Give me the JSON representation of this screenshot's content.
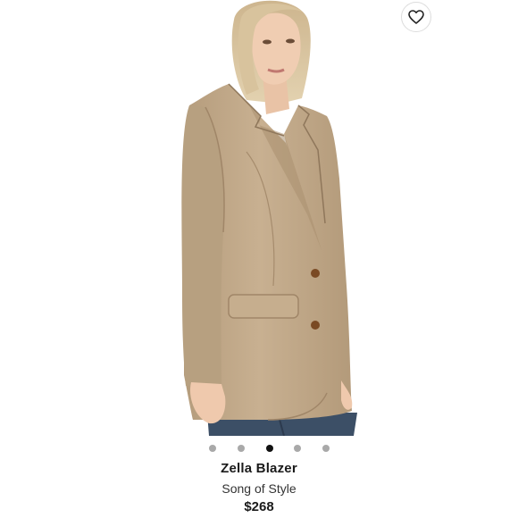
{
  "product": {
    "name": "Zella Blazer",
    "brand": "Song of Style",
    "price": "$268"
  },
  "carousel": {
    "total": 5,
    "active_index": 2
  },
  "icons": {
    "favorite": "heart-icon"
  },
  "colors": {
    "blazer": "#c3ab8a",
    "active_dot": "#111111",
    "inactive_dot": "#a9a9a9"
  }
}
